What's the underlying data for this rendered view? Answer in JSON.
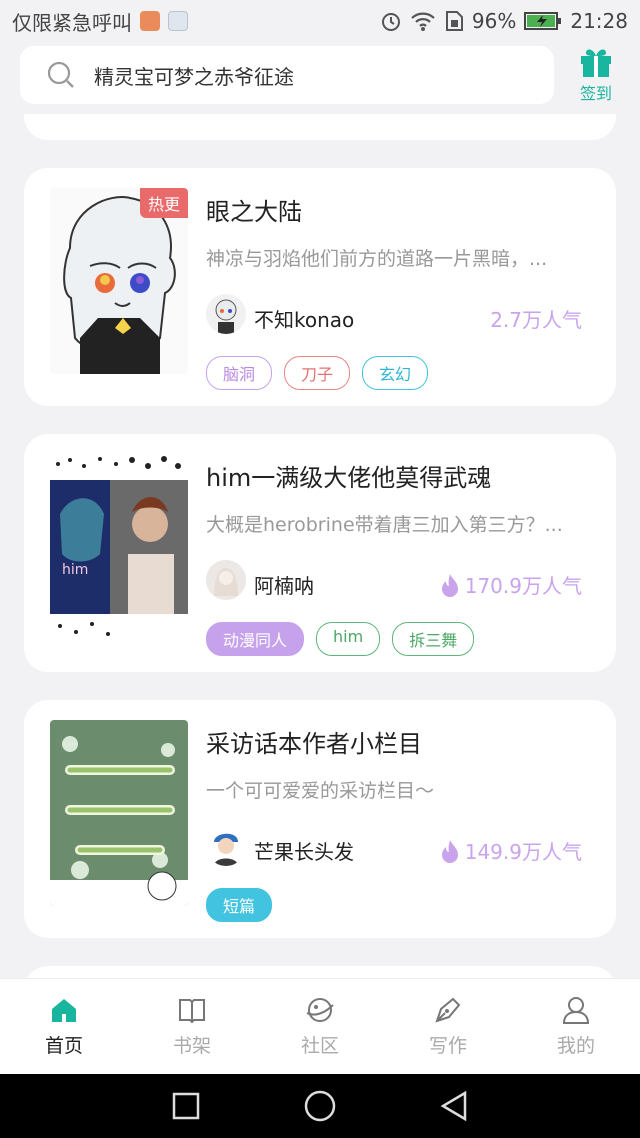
{
  "status_bar": {
    "left_text": "仅限紧急呼叫",
    "battery": "96%",
    "time": "21:28"
  },
  "search": {
    "placeholder": "精灵宝可梦之赤爷征途"
  },
  "checkin": {
    "label": "签到"
  },
  "books": [
    {
      "badge": "热更",
      "title": "眼之大陆",
      "description": "神凉与羽焰他们前方的道路一片黑暗，...",
      "author": "不知konao",
      "popularity": "2.7万人气",
      "tags": [
        {
          "label": "脑洞",
          "color": "#c7a2ec"
        },
        {
          "label": "刀子",
          "color": "#e98585"
        },
        {
          "label": "玄幻",
          "color": "#42c4e0"
        }
      ]
    },
    {
      "title": "him一满级大佬他莫得武魂",
      "description": "大概是herobrine带着唐三加入第三方？...",
      "author": "阿楠呐",
      "popularity": "170.9万人气",
      "tags": [
        {
          "label": "动漫同人",
          "style": "filled-purple"
        },
        {
          "label": "him",
          "color": "#5fb57a"
        },
        {
          "label": "拆三舞",
          "color": "#5fb57a"
        }
      ]
    },
    {
      "title": "采访话本作者小栏目",
      "description": "一个可可爱爱的采访栏目～",
      "author": "芒果长头发",
      "popularity": "149.9万人气",
      "tags": [
        {
          "label": "短篇",
          "style": "filled-teal"
        }
      ]
    }
  ],
  "nav": [
    {
      "label": "首页",
      "icon": "home-icon",
      "active": true
    },
    {
      "label": "书架",
      "icon": "book-icon",
      "active": false
    },
    {
      "label": "社区",
      "icon": "planet-icon",
      "active": false
    },
    {
      "label": "写作",
      "icon": "pen-icon",
      "active": false
    },
    {
      "label": "我的",
      "icon": "user-icon",
      "active": false
    }
  ],
  "colors": {
    "accent": "#19b69f",
    "popularity": "#c9a3ec",
    "hot_badge": "#e96a6a"
  }
}
